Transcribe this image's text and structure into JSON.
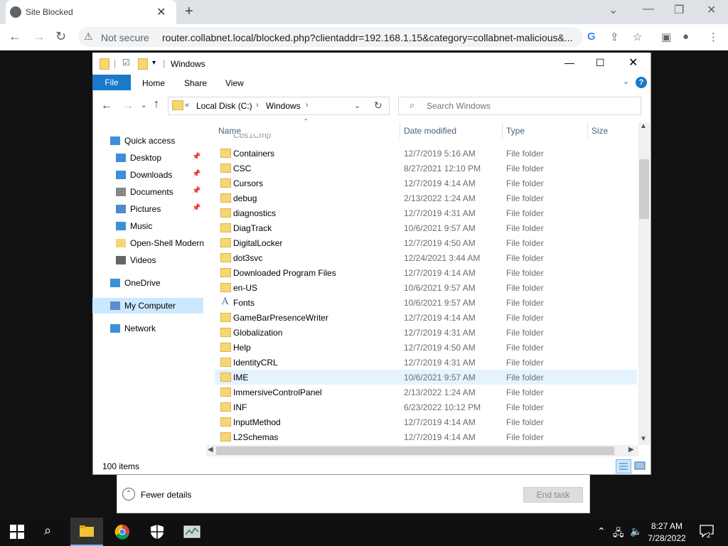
{
  "browser": {
    "tab_title": "Site Blocked",
    "security_label": "Not secure",
    "url": "router.collabnet.local/blocked.php?clientaddr=192.168.1.15&category=collabnet-malicious&..."
  },
  "task_manager": {
    "fewer_details": "Fewer details",
    "end_task": "End task"
  },
  "explorer": {
    "title": "Windows",
    "ribbon_tabs": [
      "File",
      "Home",
      "Share",
      "View"
    ],
    "address": [
      "Local Disk (C:)",
      "Windows"
    ],
    "search_placeholder": "Search Windows",
    "nav": [
      {
        "label": "Quick access"
      },
      {
        "label": "Desktop",
        "pinned": true
      },
      {
        "label": "Downloads",
        "pinned": true
      },
      {
        "label": "Documents",
        "pinned": true
      },
      {
        "label": "Pictures",
        "pinned": true
      },
      {
        "label": "Music"
      },
      {
        "label": "Open-Shell Modern"
      },
      {
        "label": "Videos"
      },
      {
        "label": "OneDrive"
      },
      {
        "label": "My Computer",
        "selected": true
      },
      {
        "label": "Network"
      }
    ],
    "columns": [
      "Name",
      "Date modified",
      "Type",
      "Size"
    ],
    "rows": [
      {
        "name": "Containers",
        "date": "12/7/2019 5:16 AM",
        "type": "File folder"
      },
      {
        "name": "CSC",
        "date": "8/27/2021 12:10 PM",
        "type": "File folder"
      },
      {
        "name": "Cursors",
        "date": "12/7/2019 4:14 AM",
        "type": "File folder"
      },
      {
        "name": "debug",
        "date": "2/13/2022 1:24 AM",
        "type": "File folder"
      },
      {
        "name": "diagnostics",
        "date": "12/7/2019 4:31 AM",
        "type": "File folder"
      },
      {
        "name": "DiagTrack",
        "date": "10/6/2021 9:57 AM",
        "type": "File folder"
      },
      {
        "name": "DigitalLocker",
        "date": "12/7/2019 4:50 AM",
        "type": "File folder"
      },
      {
        "name": "dot3svc",
        "date": "12/24/2021 3:44 AM",
        "type": "File folder"
      },
      {
        "name": "Downloaded Program Files",
        "date": "12/7/2019 4:14 AM",
        "type": "File folder"
      },
      {
        "name": "en-US",
        "date": "10/6/2021 9:57 AM",
        "type": "File folder"
      },
      {
        "name": "Fonts",
        "date": "10/6/2021 9:57 AM",
        "type": "File folder"
      },
      {
        "name": "GameBarPresenceWriter",
        "date": "12/7/2019 4:14 AM",
        "type": "File folder"
      },
      {
        "name": "Globalization",
        "date": "12/7/2019 4:31 AM",
        "type": "File folder"
      },
      {
        "name": "Help",
        "date": "12/7/2019 4:50 AM",
        "type": "File folder"
      },
      {
        "name": "IdentityCRL",
        "date": "12/7/2019 4:31 AM",
        "type": "File folder"
      },
      {
        "name": "IME",
        "date": "10/6/2021 9:57 AM",
        "type": "File folder",
        "selected": true
      },
      {
        "name": "ImmersiveControlPanel",
        "date": "2/13/2022 1:24 AM",
        "type": "File folder"
      },
      {
        "name": "INF",
        "date": "6/23/2022 10:12 PM",
        "type": "File folder"
      },
      {
        "name": "InputMethod",
        "date": "12/7/2019 4:14 AM",
        "type": "File folder"
      },
      {
        "name": "L2Schemas",
        "date": "12/7/2019 4:14 AM",
        "type": "File folder"
      }
    ],
    "status": "100 items"
  },
  "taskbar": {
    "time": "8:27 AM",
    "date": "7/28/2022",
    "notifications": "2"
  }
}
